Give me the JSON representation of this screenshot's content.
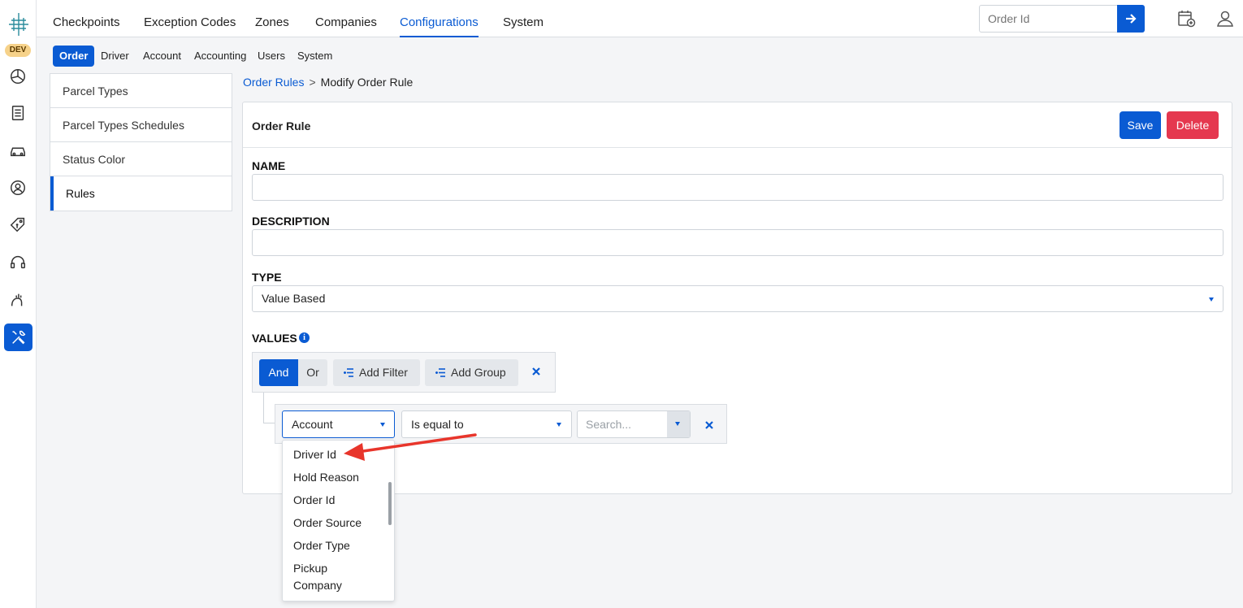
{
  "rail": {
    "env_badge": "DEV",
    "icons": [
      "logo-icon",
      "dashboard-icon",
      "document-list-icon",
      "car-icon",
      "user-circle-icon",
      "price-tag-icon",
      "headset-icon",
      "analytics-icon",
      "tools-icon"
    ]
  },
  "topnav": {
    "tabs": [
      "Checkpoints",
      "Exception Codes",
      "Zones",
      "Companies",
      "Configurations",
      "System"
    ],
    "active_tab": "Configurations",
    "order_id_placeholder": "Order Id"
  },
  "subnav": {
    "items": [
      "Order",
      "Driver",
      "Account",
      "Accounting",
      "Users",
      "System"
    ],
    "active": "Order"
  },
  "sidelist": {
    "items": [
      "Parcel Types",
      "Parcel Types Schedules",
      "Status Color",
      "Rules"
    ],
    "active": "Rules"
  },
  "breadcrumb": {
    "parent": "Order Rules",
    "separator": ">",
    "current": "Modify Order Rule"
  },
  "panel": {
    "title": "Order Rule",
    "save_label": "Save",
    "delete_label": "Delete",
    "name_label": "NAME",
    "name_value": "",
    "description_label": "DESCRIPTION",
    "description_value": "",
    "type_label": "TYPE",
    "type_value": "Value Based",
    "values_label": "VALUES"
  },
  "query_builder": {
    "and_label": "And",
    "or_label": "Or",
    "add_filter_label": "Add Filter",
    "add_group_label": "Add Group",
    "rule": {
      "field": "Account",
      "operator": "Is equal to",
      "value_placeholder": "Search..."
    },
    "field_options": [
      "Driver Id",
      "Hold Reason",
      "Order Id",
      "Order Source",
      "Order Type",
      "Pickup Company"
    ]
  },
  "colors": {
    "primary": "#0a5bd3",
    "danger": "#e5384f",
    "annotation_arrow": "#e8352b",
    "env_badge": "#f6d28a"
  }
}
